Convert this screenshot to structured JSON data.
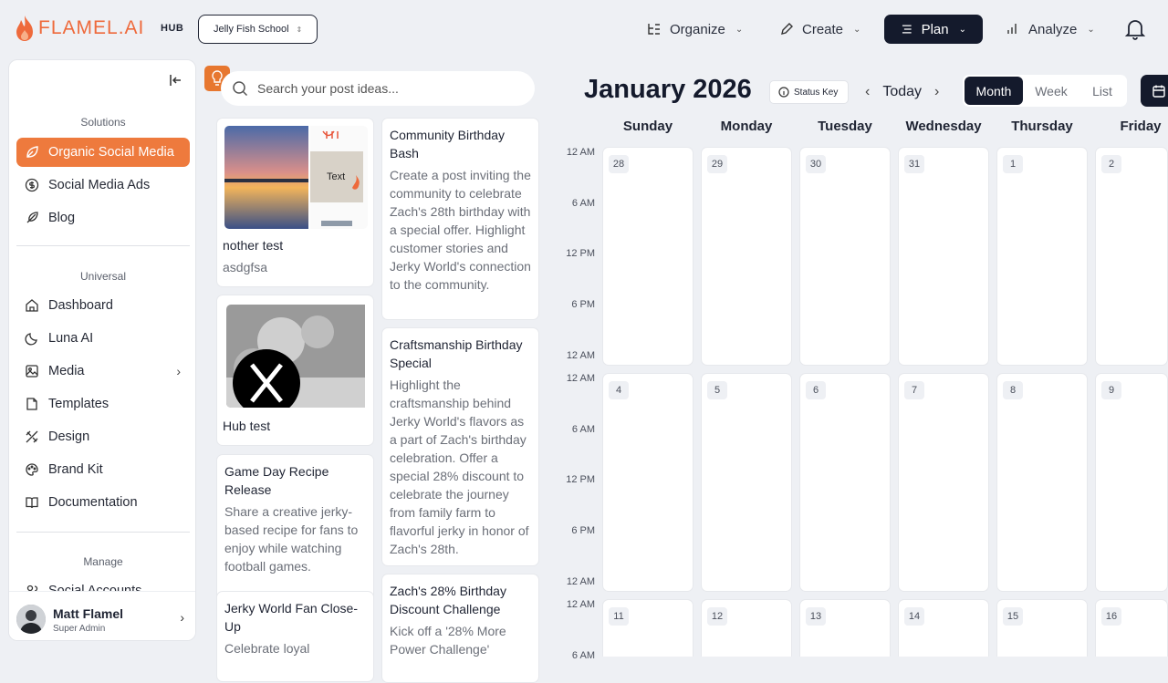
{
  "brand": {
    "name": "FLAMEL.AI",
    "hub_label": "HUB"
  },
  "workspace": {
    "name": "Jelly Fish School"
  },
  "topnav": {
    "organize": "Organize",
    "create": "Create",
    "plan": "Plan",
    "analyze": "Analyze"
  },
  "sidebar": {
    "solutions_label": "Solutions",
    "solutions": [
      "Organic Social Media",
      "Social Media Ads",
      "Blog"
    ],
    "universal_label": "Universal",
    "universal": [
      "Dashboard",
      "Luna AI",
      "Media",
      "Templates",
      "Design",
      "Brand Kit",
      "Documentation"
    ],
    "manage_label": "Manage",
    "manage": [
      "Social Accounts"
    ],
    "user": {
      "name": "Matt Flamel",
      "role": "Super Admin"
    }
  },
  "ideas": {
    "search_placeholder": "Search your post ideas...",
    "thumb_text": "Text",
    "cards": [
      {
        "title": "nother test",
        "desc": "asdgfsa"
      },
      {
        "title": "Hub test",
        "desc": ""
      },
      {
        "title": "Game Day Recipe Release",
        "desc": "Share a creative jerky-based recipe for fans to enjoy while watching football games."
      },
      {
        "title": "Jerky World Fan Close-Up",
        "desc": "Celebrate loyal"
      },
      {
        "title": "Community Birthday Bash",
        "desc": "Create a post inviting the community to celebrate Zach's 28th birthday with a special offer. Highlight customer stories and Jerky World's connection to the community."
      },
      {
        "title": "Craftsmanship Birthday Special",
        "desc": "Highlight the craftsmanship behind Jerky World's flavors as a part of Zach's birthday celebration. Offer a special 28% discount to celebrate the journey from family farm to flavorful jerky in honor of Zach's 28th."
      },
      {
        "title": "Zach's 28% Birthday Discount Challenge",
        "desc": "Kick off a '28% More Power Challenge'"
      }
    ]
  },
  "calendar": {
    "title": "January 2026",
    "status_key": "Status Key",
    "today": "Today",
    "views": [
      "Month",
      "Week",
      "List"
    ],
    "days": [
      "Sunday",
      "Monday",
      "Tuesday",
      "Wednesday",
      "Thursday",
      "Friday"
    ],
    "times": [
      "12 AM",
      "6 AM",
      "12 PM",
      "6 PM",
      "12 AM"
    ],
    "weeks": [
      [
        "28",
        "29",
        "30",
        "31",
        "1",
        "2"
      ],
      [
        "4",
        "5",
        "6",
        "7",
        "8",
        "9"
      ],
      [
        "11",
        "12",
        "13",
        "14",
        "15",
        "16"
      ]
    ]
  },
  "colors": {
    "accent": "#ee7a3d",
    "dark": "#141a2c",
    "brand": "#ee6a3c"
  }
}
